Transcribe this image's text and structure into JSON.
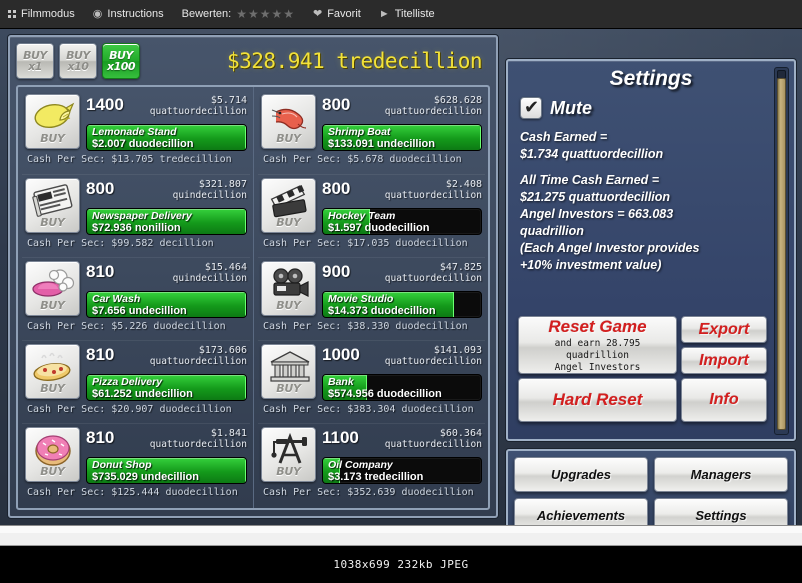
{
  "browser_bar": {
    "items": [
      {
        "icon": "fullscreen-icon",
        "label": "Filmmodus"
      },
      {
        "icon": "info-circle-icon",
        "label": "Instructions"
      },
      {
        "icon": "none",
        "label": "Bewerten:"
      },
      {
        "icon": "stars-icon",
        "label": "★★★★★"
      },
      {
        "icon": "heart-icon",
        "label": "Favorit"
      },
      {
        "icon": "play-icon",
        "label": "Titelliste"
      }
    ]
  },
  "game": {
    "cash_display": "$328.941 tredecillion",
    "buy_multipliers": [
      {
        "line1": "BUY",
        "line2": "x1",
        "active": false
      },
      {
        "line1": "BUY",
        "line2": "x10",
        "active": false
      },
      {
        "line1": "BUY",
        "line2": "x100",
        "active": true
      }
    ],
    "buy_icon_label": "BUY",
    "cps_prefix": "Cash Per Sec: ",
    "businesses_left": [
      {
        "icon": "lemon-icon",
        "qty": "1400",
        "price_line1": "$5.714",
        "price_line2": "quattuordecillion",
        "name": "Lemonade Stand",
        "value": "$2.007 duodecillion",
        "progress": 100,
        "cps": "Cash Per Sec: $13.705 tredecillion"
      },
      {
        "icon": "newspaper-icon",
        "qty": "800",
        "price_line1": "$321.807",
        "price_line2": "quindecillion",
        "name": "Newspaper Delivery",
        "value": "$72.936 nonillion",
        "progress": 100,
        "cps": "Cash Per Sec: $99.582 decillion"
      },
      {
        "icon": "carwash-icon",
        "qty": "810",
        "price_line1": "$15.464",
        "price_line2": "quindecillion",
        "name": "Car Wash",
        "value": "$7.656 undecillion",
        "progress": 100,
        "cps": "Cash Per Sec: $5.226 duodecillion"
      },
      {
        "icon": "pizza-icon",
        "qty": "810",
        "price_line1": "$173.606",
        "price_line2": "quattuordecillion",
        "name": "Pizza Delivery",
        "value": "$61.252 undecillion",
        "progress": 100,
        "cps": "Cash Per Sec: $20.907 duodecillion"
      },
      {
        "icon": "donut-icon",
        "qty": "810",
        "price_line1": "$1.841",
        "price_line2": "quattuordecillion",
        "name": "Donut Shop",
        "value": "$735.029 undecillion",
        "progress": 100,
        "cps": "Cash Per Sec: $125.444 duodecillion"
      }
    ],
    "businesses_right": [
      {
        "icon": "shrimp-icon",
        "qty": "800",
        "price_line1": "$628.628",
        "price_line2": "quattuordecillion",
        "name": "Shrimp Boat",
        "value": "$133.091 undecillion",
        "progress": 100,
        "cps": "Cash Per Sec: $5.678 duodecillion"
      },
      {
        "icon": "hockey-icon",
        "qty": "800",
        "price_line1": "$2.408",
        "price_line2": "quattuordecillion",
        "name": "Hockey Team",
        "value": "$1.597 duodecillion",
        "progress": 30,
        "cps": "Cash Per Sec: $17.035 duodecillion"
      },
      {
        "icon": "movie-icon",
        "qty": "900",
        "price_line1": "$47.825",
        "price_line2": "quattuordecillion",
        "name": "Movie Studio",
        "value": "$14.373 duodecillion",
        "progress": 83,
        "cps": "Cash Per Sec: $38.330 duodecillion"
      },
      {
        "icon": "bank-icon",
        "qty": "1000",
        "price_line1": "$141.093",
        "price_line2": "quattuordecillion",
        "name": "Bank",
        "value": "$574.956 duodecillion",
        "progress": 28,
        "cps": "Cash Per Sec: $383.304 duodecillion"
      },
      {
        "icon": "oil-icon",
        "qty": "1100",
        "price_line1": "$60.364",
        "price_line2": "quattuordecillion",
        "name": "Oil Company",
        "value": "$3.173 tredecillion",
        "progress": 11,
        "cps": "Cash Per Sec: $352.639 duodecillion"
      }
    ]
  },
  "settings": {
    "title": "Settings",
    "mute_label": "Mute",
    "mute_checked": true,
    "cash_earned_label": "Cash Earned =",
    "cash_earned_value": "$1.734 quattuordecillion",
    "all_time_label": "All Time Cash Earned =",
    "all_time_value": "$21.275 quattuordecillion",
    "angel_line1": "Angel Investors = 663.083",
    "angel_line2": "quadrillion",
    "angel_note1": "(Each Angel Investor provides",
    "angel_note2": "+10% investment value)",
    "reset_game_label": "Reset Game",
    "reset_game_sub1": "and earn 28.795",
    "reset_game_sub2": "quadrillion",
    "reset_game_sub3": "Angel Investors",
    "hard_reset_label": "Hard Reset",
    "export_label": "Export",
    "import_label": "Import",
    "info_label": "Info"
  },
  "menu": {
    "buttons": [
      "Upgrades",
      "Managers",
      "Achievements",
      "Settings"
    ]
  },
  "status_bar": {
    "text": "1038x699 232kb JPEG"
  },
  "colors": {
    "accent_green": "#23ab2b",
    "cash_yellow": "#f2e23a",
    "panel_blue": "#3f5173",
    "red_text": "#d31f1f"
  }
}
